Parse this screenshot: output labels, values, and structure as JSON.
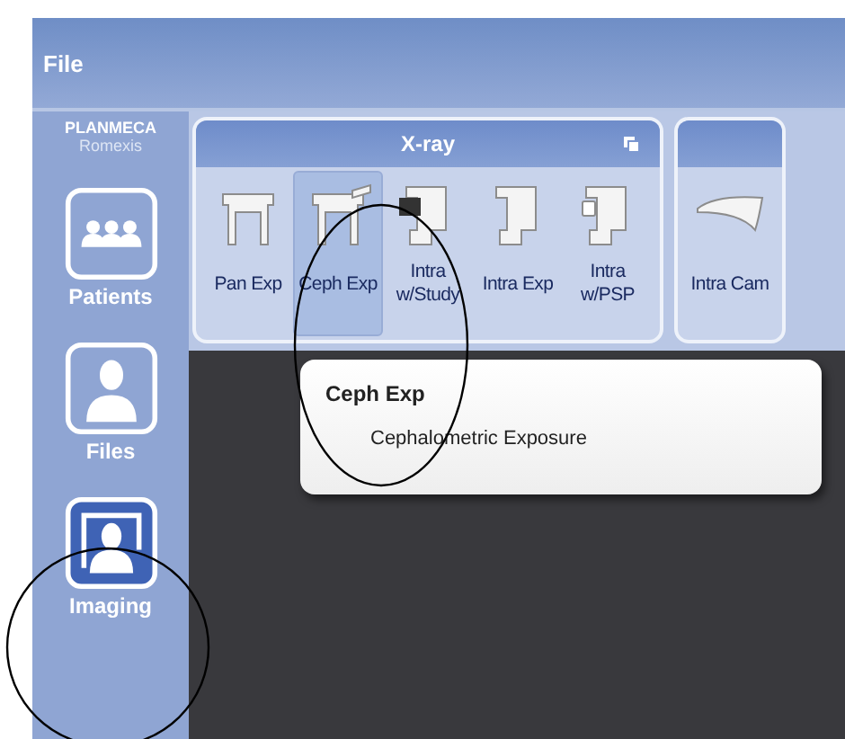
{
  "menu_bar": {
    "items": [
      "File"
    ]
  },
  "logo": {
    "brand": "PLANMECA",
    "product": "Romexis"
  },
  "sidebar": {
    "items": [
      {
        "label": "Patients",
        "kind": "patients",
        "selected": false
      },
      {
        "label": "Files",
        "kind": "files",
        "selected": false
      },
      {
        "label": "Imaging",
        "kind": "imaging",
        "selected": true
      }
    ]
  },
  "ribbon": {
    "groups": [
      {
        "title": "X-ray",
        "tools": [
          {
            "label": "Pan Exp",
            "kind": "pan",
            "selected": false
          },
          {
            "label": "Ceph Exp",
            "kind": "ceph",
            "selected": true
          },
          {
            "label": "Intra w/Study",
            "kind": "study",
            "selected": false
          },
          {
            "label": "Intra Exp",
            "kind": "intra",
            "selected": false
          },
          {
            "label": "Intra w/PSP",
            "kind": "psp",
            "selected": false
          }
        ]
      },
      {
        "tools": [
          {
            "label": "Intra Cam",
            "kind": "cam",
            "selected": false
          }
        ]
      }
    ]
  },
  "tooltip": {
    "title": "Ceph Exp",
    "description": "Cephalometric Exposure"
  }
}
